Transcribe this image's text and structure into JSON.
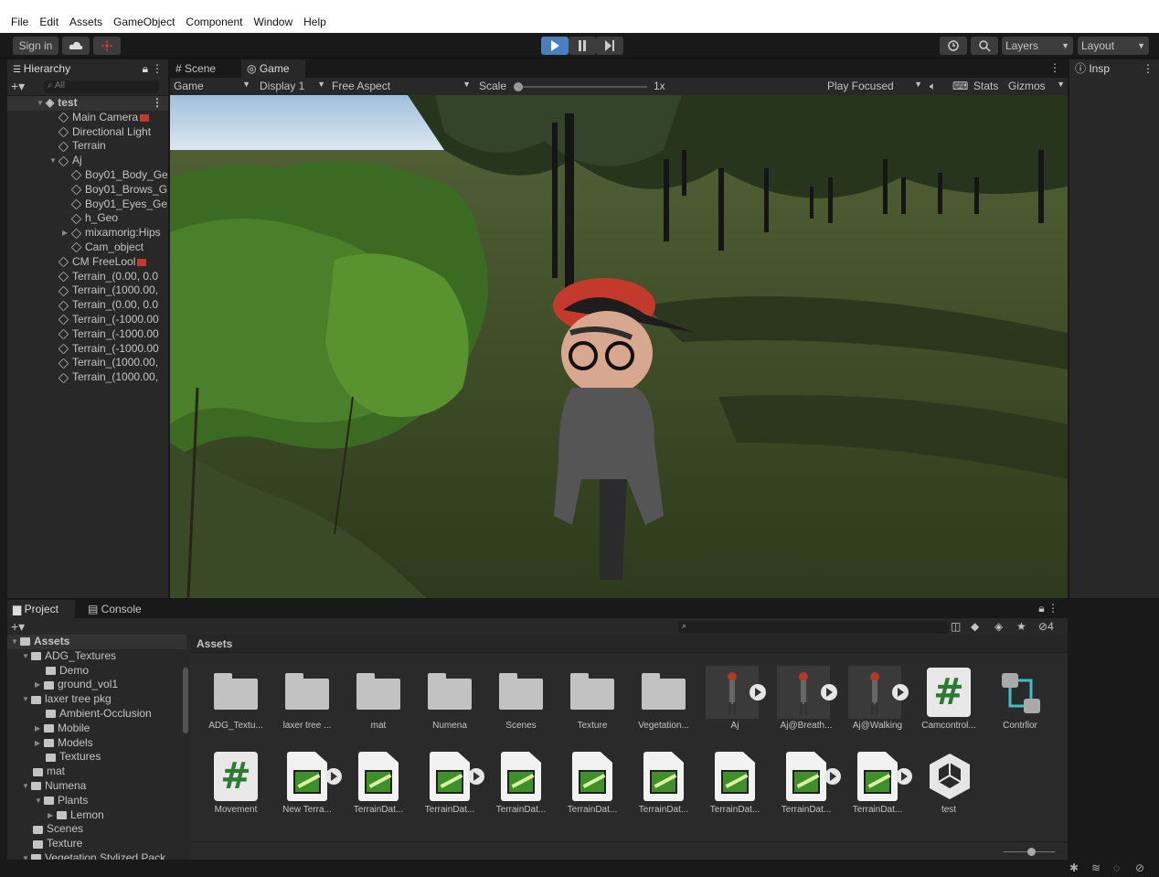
{
  "menu": {
    "items": [
      "File",
      "Edit",
      "Assets",
      "GameObject",
      "Component",
      "Window",
      "Help"
    ]
  },
  "toolbar": {
    "sign_in": "Sign in",
    "layers": "Layers",
    "layout": "Layout"
  },
  "hierarchy": {
    "tab": "Hierarchy",
    "search_placeholder": "All",
    "scene": "test",
    "items": [
      "Main Camera",
      "Directional Light",
      "Terrain",
      "Aj",
      "Boy01_Body_Ge",
      "Boy01_Brows_G",
      "Boy01_Eyes_Ge",
      "h_Geo",
      "mixamorig:Hips",
      "Cam_object",
      "CM FreeLool",
      "Terrain_(0.00, 0.0",
      "Terrain_(1000.00,",
      "Terrain_(0.00, 0.0",
      "Terrain_(-1000.00",
      "Terrain_(-1000.00",
      "Terrain_(-1000.00",
      "Terrain_(1000.00,",
      "Terrain_(1000.00,"
    ]
  },
  "views": {
    "scene_tab": "Scene",
    "game_tab": "Game",
    "inspector_tab": "Insp",
    "game_dropdown": "Game",
    "display": "Display 1",
    "aspect": "Free Aspect",
    "scale_label": "Scale",
    "scale_value": "1x",
    "play_focused": "Play Focused",
    "stats": "Stats",
    "gizmos": "Gizmos"
  },
  "project": {
    "tab_project": "Project",
    "tab_console": "Console",
    "hidden_count": "4",
    "tree": [
      "Assets",
      "ADG_Textures",
      "Demo",
      "ground_vol1",
      "laxer tree pkg",
      "Ambient-Occlusion",
      "Mobile",
      "Models",
      "Textures",
      "mat",
      "Numena",
      "Plants",
      "Lemon",
      "Scenes",
      "Texture",
      "Vegetation Stylized Pack"
    ],
    "breadcrumb": "Assets",
    "assets_row1": [
      "ADG_Textu...",
      "laxer tree ...",
      "mat",
      "Numena",
      "Scenes",
      "Texture",
      "Vegetation...",
      "Aj",
      "Aj@Breath...",
      "Aj@Walking",
      "Camcontrol...",
      "Contrllor"
    ],
    "assets_row2": [
      "Movement",
      "New Terra...",
      "TerrainDat...",
      "TerrainDat...",
      "TerrainDat...",
      "TerrainDat...",
      "TerrainDat...",
      "TerrainDat...",
      "TerrainDat...",
      "TerrainDat...",
      "test"
    ]
  },
  "colors": {
    "accent": "#4a7fbf",
    "selection": "#2c5d87",
    "panel": "#282828",
    "dark": "#191919"
  }
}
